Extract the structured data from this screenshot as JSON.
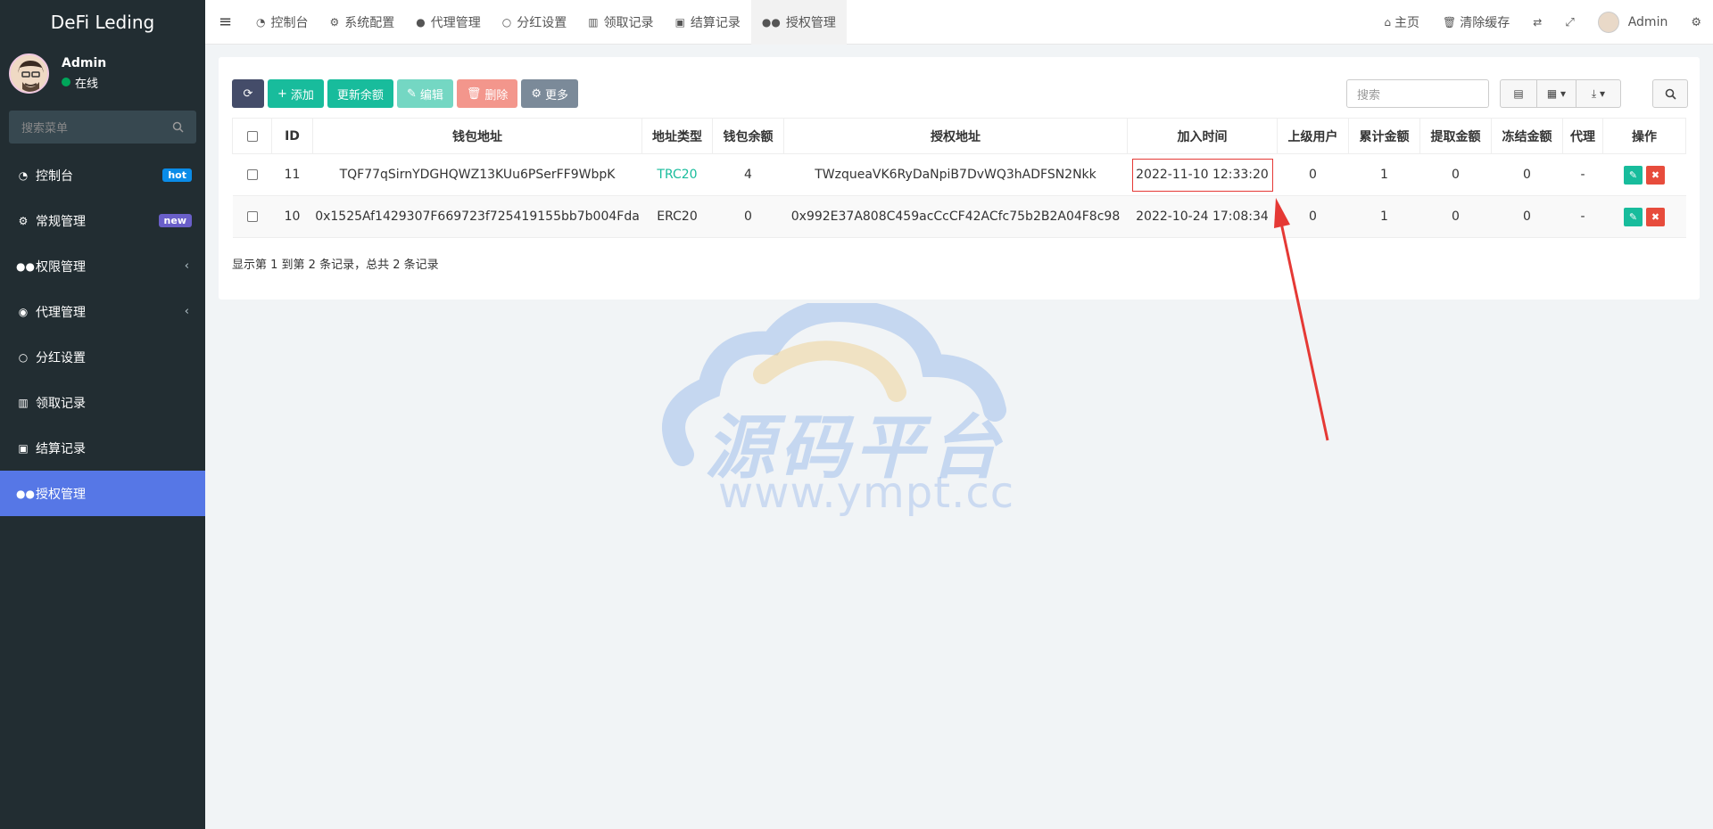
{
  "brand": "DeFi Leding",
  "user": {
    "name": "Admin",
    "status": "在线"
  },
  "sidebar": {
    "search_placeholder": "搜索菜单",
    "items": [
      {
        "label": "控制台",
        "icon": "dashboard-icon",
        "badge": "hot"
      },
      {
        "label": "常规管理",
        "icon": "cogs-icon",
        "badge": "new"
      },
      {
        "label": "权限管理",
        "icon": "group-icon",
        "chevron": "‹"
      },
      {
        "label": "代理管理",
        "icon": "user-circle-icon",
        "chevron": "‹"
      },
      {
        "label": "分红设置",
        "icon": "circle-icon"
      },
      {
        "label": "领取记录",
        "icon": "bars-icon"
      },
      {
        "label": "结算记录",
        "icon": "cc-icon"
      },
      {
        "label": "授权管理",
        "icon": "group-icon",
        "active": true
      }
    ]
  },
  "header": {
    "tabs": [
      {
        "label": "控制台"
      },
      {
        "label": "系统配置"
      },
      {
        "label": "代理管理"
      },
      {
        "label": "分红设置"
      },
      {
        "label": "领取记录"
      },
      {
        "label": "结算记录"
      },
      {
        "label": "授权管理",
        "active": true
      }
    ],
    "right": {
      "home": "主页",
      "clear_cache": "清除缓存",
      "user": "Admin"
    }
  },
  "toolbar": {
    "add": "添加",
    "update_balance": "更新余额",
    "edit": "编辑",
    "delete": "删除",
    "more": "更多",
    "search_placeholder": "搜索"
  },
  "table": {
    "headers": [
      "ID",
      "钱包地址",
      "地址类型",
      "钱包余额",
      "授权地址",
      "加入时间",
      "上级用户",
      "累计金额",
      "提取金额",
      "冻结金额",
      "代理",
      "操作"
    ],
    "rows": [
      {
        "id": "11",
        "wallet": "TQF77qSirnYDGHQWZ13KUu6PSerFF9WbpK",
        "type": "TRC20",
        "balance": "4",
        "auth": "TWzqueaVK6RyDaNpiB7DvWQ3hADFSN2Nkk",
        "time": "2022-11-10 12:33:20",
        "parent": "0",
        "total": "1",
        "withdrawn": "0",
        "frozen": "0",
        "agent": "-"
      },
      {
        "id": "10",
        "wallet": "0x1525Af1429307F669723f725419155bb7b004Fda",
        "type": "ERC20",
        "balance": "0",
        "auth": "0x992E37A808C459acCcCF42ACfc75b2B2A04F8c98",
        "time": "2022-10-24 17:08:34",
        "parent": "0",
        "total": "1",
        "withdrawn": "0",
        "frozen": "0",
        "agent": "-"
      }
    ],
    "summary": "显示第 1 到第 2 条记录，总共 2 条记录"
  },
  "watermark": {
    "text": "源码平台",
    "url": "www.ympt.cc"
  },
  "colors": {
    "sidebar": "#222d32",
    "active": "#5677e6",
    "green": "#18bc9c",
    "red": "#e74c3c",
    "annotation": "#e53935"
  }
}
